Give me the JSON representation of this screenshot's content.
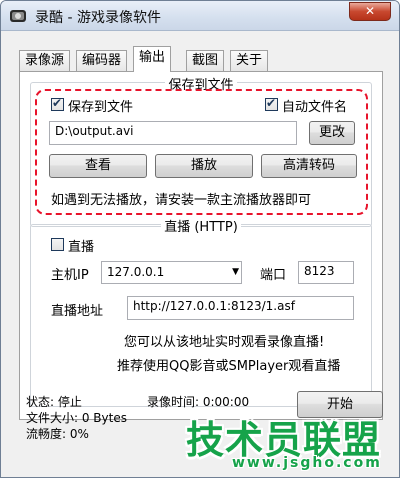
{
  "window": {
    "title": "录酷 - 游戏录像软件",
    "close_label": "✕"
  },
  "tabs": [
    {
      "label": "录像源"
    },
    {
      "label": "编码器"
    },
    {
      "label": "输出"
    },
    {
      "label": "截图"
    },
    {
      "label": "关于"
    }
  ],
  "active_tab": "输出",
  "save_group": {
    "title": "保存到文件",
    "save_to_file_label": "保存到文件",
    "save_to_file_checked": true,
    "auto_filename_label": "自动文件名",
    "auto_filename_checked": true,
    "path_value": "D:\\output.avi",
    "change_button": "更改",
    "view_button": "查看",
    "play_button": "播放",
    "hd_convert_button": "高清转码",
    "hint": "如遇到无法播放，请安装一款主流播放器即可"
  },
  "live_group": {
    "title": "直播 (HTTP)",
    "live_label": "直播",
    "live_checked": false,
    "host_ip_label": "主机IP",
    "host_ip_value": "127.0.0.1",
    "port_label": "端口",
    "port_value": "8123",
    "address_label": "直播地址",
    "address_value": "http://127.0.0.1:8123/1.asf",
    "info_line1": "您可以从该地址实时观看录像直播!",
    "info_line2": "推荐使用QQ影音或SMPlayer观看直播"
  },
  "status": {
    "state": "状态: 停止",
    "record_time": "录像时间: 0:00:00",
    "file_size": "文件大小: 0 Bytes",
    "fluency": "流畅度: 0%",
    "start_button": "开始"
  },
  "watermark": {
    "big": "技术员联盟",
    "small": "www.jsgho.com"
  },
  "colors": {
    "dashed_highlight": "#e8132b",
    "watermark": "#16a34a"
  }
}
